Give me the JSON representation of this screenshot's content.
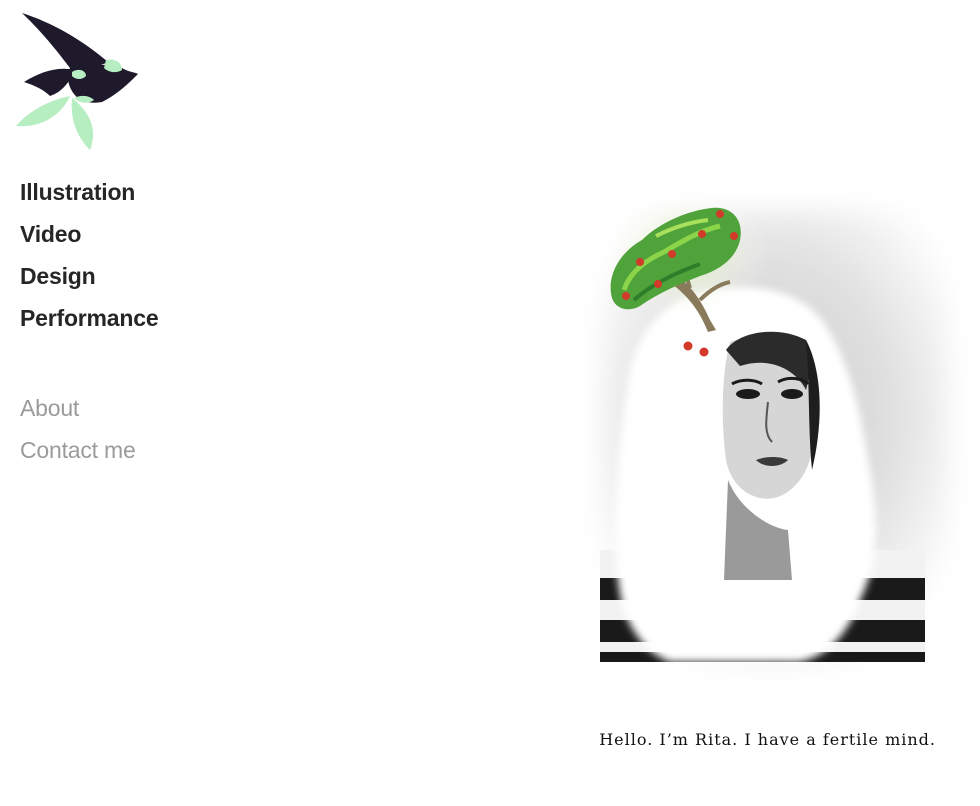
{
  "logo": {
    "icon": "bird-leaf-logo-icon",
    "colors": {
      "dark": "#1f1a2b",
      "leaf": "#b6edc1"
    }
  },
  "main_nav": [
    {
      "label": "Illustration"
    },
    {
      "label": "Video"
    },
    {
      "label": "Design"
    },
    {
      "label": "Performance"
    }
  ],
  "secondary_nav": [
    {
      "label": "About"
    },
    {
      "label": "Contact me"
    }
  ],
  "hero": {
    "tagline": "Hello. I’m Rita. I have a fertile mind."
  },
  "colors": {
    "nav_primary": "#262626",
    "nav_secondary": "#9b9b9b",
    "tree_green": "#4fa33a",
    "fruit_red": "#d23a2a"
  }
}
